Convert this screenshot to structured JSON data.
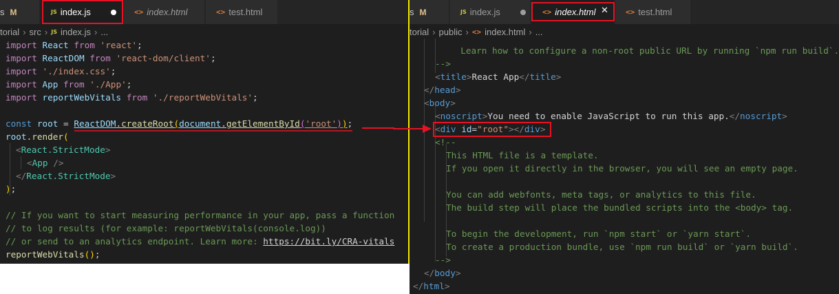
{
  "left_editor": {
    "tabs": {
      "prev_partial": "s",
      "prev_status": "M",
      "active": {
        "icon": "JS",
        "label": "index.js"
      },
      "tab2": {
        "label": "index.html"
      },
      "tab3": {
        "label": "test.html"
      }
    },
    "breadcrumb": [
      "torial",
      "src",
      "index.js",
      "..."
    ],
    "breadcrumb_file_icon": "JS",
    "code": {
      "l1": [
        "import",
        "React",
        "from",
        "'react'",
        ";"
      ],
      "l2": [
        "import",
        "ReactDOM",
        "from",
        "'react-dom/client'",
        ";"
      ],
      "l3": [
        "import",
        "'./index.css'",
        ";"
      ],
      "l4": [
        "import",
        "App",
        "from",
        "'./App'",
        ";"
      ],
      "l5": [
        "import",
        "reportWebVitals",
        "from",
        "'./reportWebVitals'",
        ";"
      ],
      "l7": [
        "const",
        "root",
        " = ",
        "ReactDOM",
        ".",
        "createRoot",
        "(",
        "document",
        ".",
        "getElementById",
        "(",
        "'root'",
        ")",
        ")",
        ";"
      ],
      "l8": [
        "root",
        ".",
        "render",
        "("
      ],
      "l9": [
        "<",
        "React.StrictMode",
        ">"
      ],
      "l10": [
        "<",
        "App",
        " />"
      ],
      "l11": [
        "</",
        "React.StrictMode",
        ">"
      ],
      "l12": [
        ")",
        ";"
      ],
      "l14": "// If you want to start measuring performance in your app, pass a function",
      "l15": "// to log results (for example: reportWebVitals(console.log))",
      "l16": [
        "// or send to an analytics endpoint. Learn more: ",
        "https://bit.ly/CRA-vitals"
      ],
      "l17": [
        "reportWebVitals",
        "(",
        ")",
        ";"
      ]
    }
  },
  "right_editor": {
    "tabs": {
      "prev_partial": "s",
      "prev_status": "M",
      "tab1": {
        "icon": "JS",
        "label": "index.js"
      },
      "active": {
        "label": "index.html"
      },
      "tab3": {
        "label": "test.html"
      }
    },
    "breadcrumb": [
      "torial",
      "public",
      "index.html",
      "..."
    ],
    "code": {
      "l0": "     Learn how to configure a non-root public URL by running `npm run build`.",
      "l1": "-->",
      "l2": [
        "<",
        "title",
        ">",
        "React App",
        "</",
        "title",
        ">"
      ],
      "l3": [
        "</",
        "head",
        ">"
      ],
      "l4": [
        "<",
        "body",
        ">"
      ],
      "l5": [
        "<",
        "noscript",
        ">",
        "You need to enable JavaScript to run this app.",
        "</",
        "noscript",
        ">"
      ],
      "l6": [
        "<",
        "div",
        " ",
        "id",
        "=",
        "\"root\"",
        ">",
        "</",
        "div",
        ">"
      ],
      "l7": "<!--",
      "l8": "This HTML file is a template.",
      "l9": "If you open it directly in the browser, you will see an empty page.",
      "l11": "You can add webfonts, meta tags, or analytics to this file.",
      "l12": "The build step will place the bundled scripts into the <body> tag.",
      "l14": "To begin the development, run `npm start` or `yarn start`.",
      "l15": "To create a production bundle, use `npm run build` or `yarn build`.",
      "l16": "-->",
      "l17": [
        "</",
        "body",
        ">"
      ],
      "l18": [
        "</",
        "html",
        ">"
      ]
    }
  },
  "colors": {
    "annotation_red": "#e81224",
    "split_divider": "#f2e600",
    "editor_bg": "#1e1e1e"
  },
  "icons": [
    "js-file-icon",
    "html-file-icon",
    "unsaved-dot-icon",
    "close-icon",
    "arrow-annotation"
  ]
}
